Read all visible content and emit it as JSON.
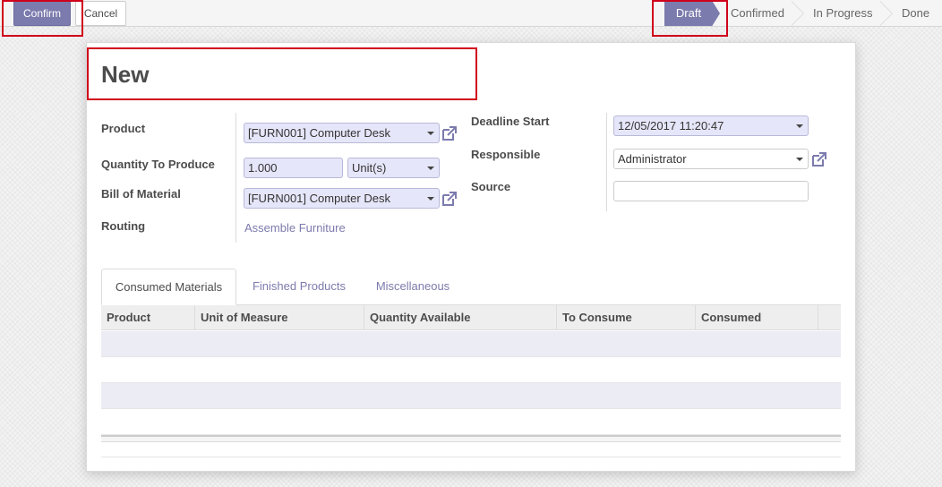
{
  "toolbar": {
    "confirm_label": "Confirm",
    "cancel_label": "Cancel"
  },
  "status": {
    "stages": [
      "Draft",
      "Confirmed",
      "In Progress",
      "Done"
    ],
    "active": "Draft"
  },
  "form": {
    "title": "New",
    "left": {
      "product_label": "Product",
      "product_value": "[FURN001] Computer Desk",
      "qty_label": "Quantity To Produce",
      "qty_value": "1.000",
      "uom_value": "Unit(s)",
      "bom_label": "Bill of Material",
      "bom_value": "[FURN001] Computer Desk",
      "routing_label": "Routing",
      "routing_value": "Assemble Furniture"
    },
    "right": {
      "deadline_label": "Deadline Start",
      "deadline_value": "12/05/2017 11:20:47",
      "responsible_label": "Responsible",
      "responsible_value": "Administrator",
      "source_label": "Source",
      "source_value": ""
    }
  },
  "tabs": [
    "Consumed Materials",
    "Finished Products",
    "Miscellaneous"
  ],
  "table": {
    "columns": [
      "Product",
      "Unit of Measure",
      "Quantity Available",
      "To Consume",
      "Consumed"
    ],
    "rows": []
  },
  "colors": {
    "accent": "#7c7bad",
    "highlight": "#d0021b",
    "required_field": "#e6e6fa"
  },
  "icons": {
    "external_link": "external-link-icon",
    "dropdown": "chevron-down-icon"
  }
}
